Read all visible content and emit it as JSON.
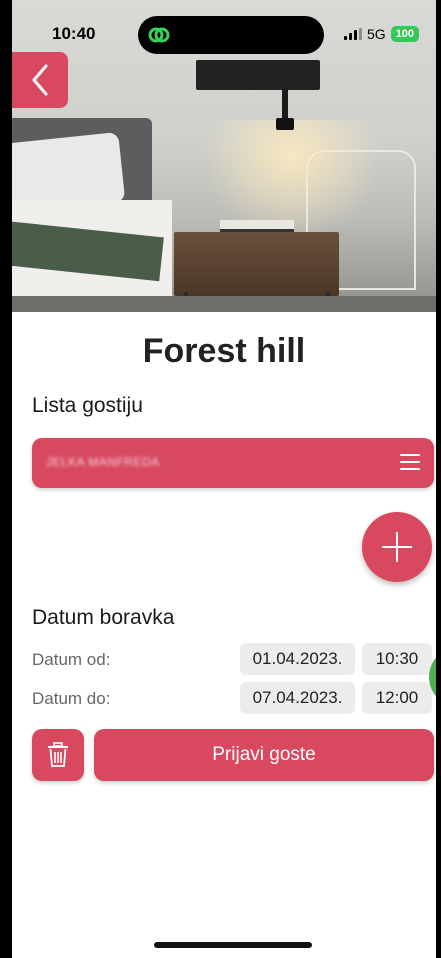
{
  "status_bar": {
    "time": "10:40",
    "network": "5G",
    "battery": "100",
    "island_icon": "link-rings-icon"
  },
  "nav": {
    "back_icon": "chevron-left-icon"
  },
  "page": {
    "title": "Forest hill"
  },
  "guests": {
    "section_label": "Lista gostiju",
    "items": [
      {
        "name": "JELKA MANFREDA"
      }
    ],
    "menu_icon": "hamburger-icon",
    "add_icon": "plus-icon"
  },
  "stay": {
    "section_label": "Datum boravka",
    "from_label": "Datum od:",
    "from_date": "01.04.2023.",
    "from_time": "10:30",
    "to_label": "Datum do:",
    "to_date": "07.04.2023.",
    "to_time": "12:00"
  },
  "actions": {
    "delete_icon": "trash-icon",
    "submit_label": "Prijavi goste"
  },
  "colors": {
    "accent": "#d84960",
    "chip_bg": "#ececec",
    "battery": "#34c759"
  }
}
